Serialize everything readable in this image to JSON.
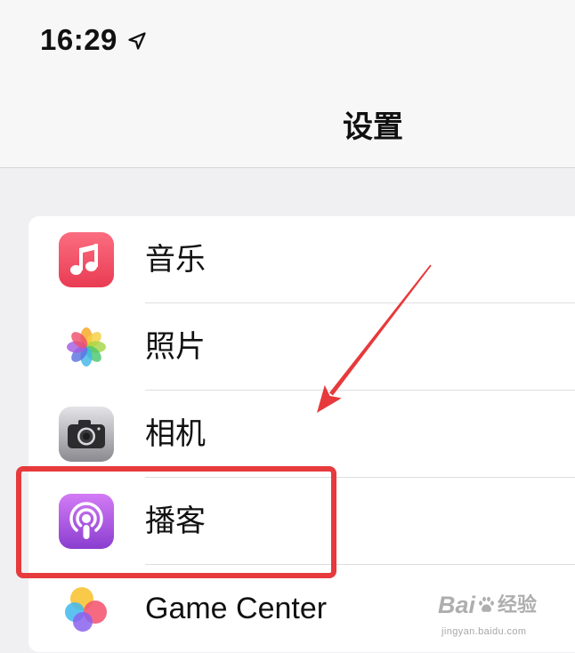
{
  "status_bar": {
    "time": "16:29",
    "location_icon": "location-arrow-icon"
  },
  "nav": {
    "title": "设置"
  },
  "settings_list": {
    "items": [
      {
        "label": "音乐",
        "icon": "music-icon"
      },
      {
        "label": "照片",
        "icon": "photos-icon"
      },
      {
        "label": "相机",
        "icon": "camera-icon"
      },
      {
        "label": "播客",
        "icon": "podcasts-icon",
        "highlighted": true
      },
      {
        "label": "Game Center",
        "icon": "game-center-icon"
      }
    ]
  },
  "annotation": {
    "color": "#e63a3c",
    "arrow_icon": "pointer-arrow-icon"
  },
  "watermark": {
    "logo_text": "Bai",
    "logo_icon": "paw-icon",
    "logo_text_cn": "经验",
    "url": "jingyan.baidu.com"
  },
  "colors": {
    "header_bg": "#f7f7f7",
    "page_bg": "#f0f0f2",
    "card_bg": "#ffffff",
    "separator": "#dedede",
    "text": "#111111"
  }
}
